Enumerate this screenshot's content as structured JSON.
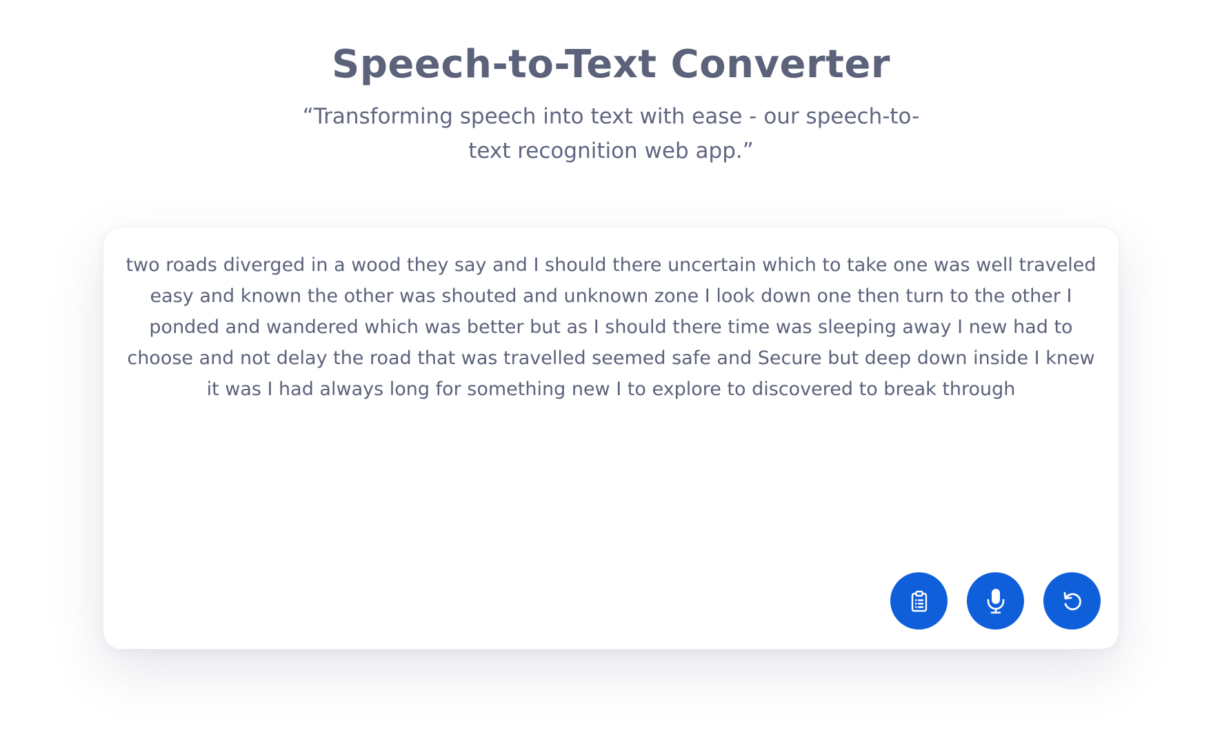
{
  "header": {
    "title": "Speech-to-Text Converter",
    "subtitle": "“Transforming speech into text with ease - our speech-to-text recognition web app.”"
  },
  "transcript": {
    "text": "two roads diverged in a wood they say and I should there uncertain which to take one was well traveled easy and known the other was shouted and unknown zone I look down one then turn to the other I ponded and wandered which was better but as I should there time was sleeping away I new had to choose and not delay the road that was travelled seemed safe and Secure but deep down inside I knew it was I had always long for something new I to explore to discovered to break through"
  },
  "actions": [
    {
      "name": "copy-button",
      "icon": "clipboard-icon"
    },
    {
      "name": "record-button",
      "icon": "microphone-icon"
    },
    {
      "name": "reset-button",
      "icon": "rotate-icon"
    }
  ],
  "colors": {
    "accent": "#0f5fdb",
    "text": "#5b627a",
    "background": "#ffffff"
  }
}
